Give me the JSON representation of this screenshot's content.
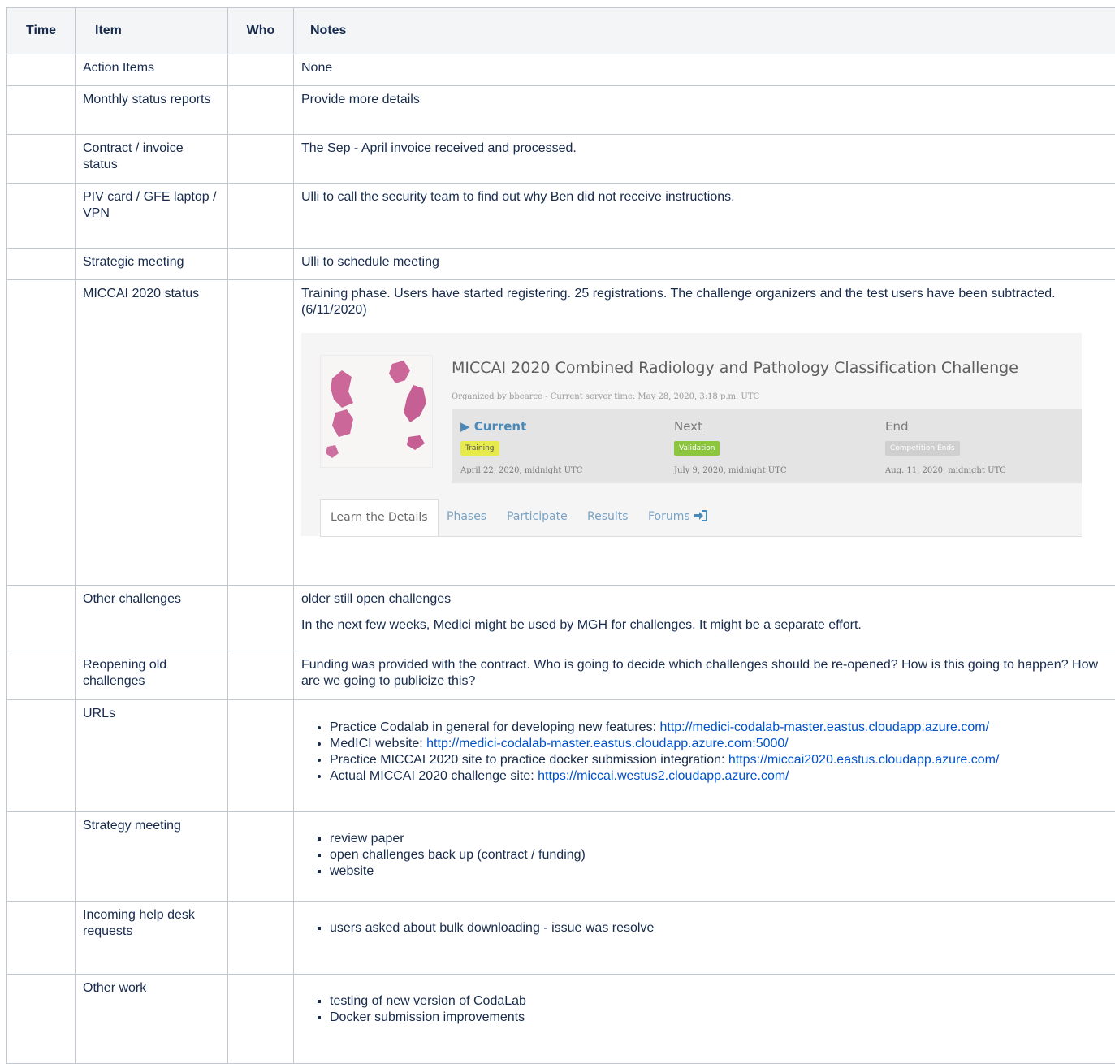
{
  "headers": {
    "time": "Time",
    "item": "Item",
    "who": "Who",
    "notes": "Notes"
  },
  "rows": [
    {
      "time": "",
      "item": "Action Items",
      "who": "",
      "notes": [
        "None"
      ]
    },
    {
      "time": "",
      "item": "Monthly status reports",
      "who": "",
      "notes": [
        "Provide more details"
      ]
    },
    {
      "time": "",
      "item": "Contract / invoice status",
      "who": "",
      "notes": [
        "The Sep - April invoice received and processed."
      ]
    },
    {
      "time": "",
      "item": "PIV card / GFE laptop / VPN",
      "who": "",
      "notes": [
        "Ulli to call the security team to find out why Ben did not receive instructions."
      ]
    },
    {
      "time": "",
      "item": "Strategic meeting",
      "who": "",
      "notes": [
        "Ulli to schedule meeting"
      ]
    },
    {
      "time": "",
      "item": "MICCAI 2020 status",
      "who": "",
      "notes": [
        "Training phase. Users have started registering. 25 registrations. The challenge organizers and the test users have been subtracted. (6/11/2020)"
      ]
    },
    {
      "time": "",
      "item": "Other challenges",
      "who": "",
      "notes": [
        "older still open challenges",
        "In the next few weeks, Medici might be used by MGH for challenges. It might be a separate effort."
      ]
    },
    {
      "time": "",
      "item": "Reopening old challenges",
      "who": "",
      "notes": [
        "Funding was provided with the contract. Who is going to decide which challenges should be re-opened? How is this going to happen? How are we going to publicize this?"
      ]
    },
    {
      "time": "",
      "item": "URLs",
      "who": "",
      "links": [
        {
          "text": "Practice Codalab in general for developing new features: ",
          "url": "http://medici-codalab-master.eastus.cloudapp.azure.com/"
        },
        {
          "text": "MedICI website: ",
          "url": "http://medici-codalab-master.eastus.cloudapp.azure.com:5000/"
        },
        {
          "text": "Practice MICCAI 2020 site to practice docker submission integration: ",
          "url": "https://miccai2020.eastus.cloudapp.azure.com/"
        },
        {
          "text": "Actual MICCAI 2020 challenge site: ",
          "url": "https://miccai.westus2.cloudapp.azure.com/"
        }
      ]
    },
    {
      "time": "",
      "item": "Strategy meeting",
      "who": "",
      "bullets": [
        "review paper",
        "open challenges back up (contract / funding)",
        "website"
      ]
    },
    {
      "time": "",
      "item": "Incoming help desk requests",
      "who": "",
      "bullets": [
        "users asked about bulk downloading - issue was resolve"
      ]
    },
    {
      "time": "",
      "item": "Other work",
      "who": "",
      "bullets": [
        "testing of new version of CodaLab",
        "Docker submission improvements"
      ]
    }
  ],
  "challenge": {
    "title": "MICCAI 2020 Combined Radiology and Pathology Classification Challenge",
    "subtitle": "Organized by bbearce - Current server time: May 28, 2020, 3:18 p.m. UTC",
    "phases": [
      {
        "label": "▶ Current",
        "badge": "Training",
        "badge_color": "#e6ea4a",
        "badge_text_color": "#555555",
        "date": "April 22, 2020, midnight UTC"
      },
      {
        "label": "Next",
        "badge": "Validation",
        "badge_color": "#8cc63f",
        "badge_text_color": "#ffffff",
        "date": "July 9, 2020, midnight UTC"
      },
      {
        "label": "End",
        "badge": "Competition Ends",
        "badge_color": "#cfcfcf",
        "badge_text_color": "#ffffff",
        "date": "Aug. 11, 2020, midnight UTC"
      }
    ],
    "tabs": [
      "Learn the Details",
      "Phases",
      "Participate",
      "Results",
      "Forums"
    ],
    "forum_icon": "sign-in-icon"
  },
  "colors": {
    "link": "#0052cc",
    "header_bg": "#f4f5f7",
    "border": "#c1c7d0",
    "tissue": "#c5588f"
  }
}
